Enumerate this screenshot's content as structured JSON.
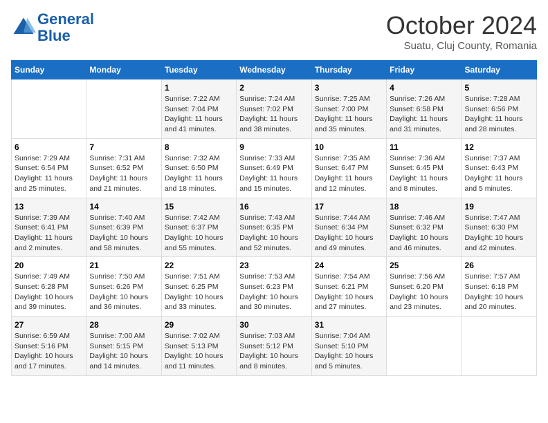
{
  "header": {
    "logo_line1": "General",
    "logo_line2": "Blue",
    "month": "October 2024",
    "location": "Suatu, Cluj County, Romania"
  },
  "weekdays": [
    "Sunday",
    "Monday",
    "Tuesday",
    "Wednesday",
    "Thursday",
    "Friday",
    "Saturday"
  ],
  "weeks": [
    [
      {
        "day": "",
        "info": ""
      },
      {
        "day": "",
        "info": ""
      },
      {
        "day": "1",
        "info": "Sunrise: 7:22 AM\nSunset: 7:04 PM\nDaylight: 11 hours and 41 minutes."
      },
      {
        "day": "2",
        "info": "Sunrise: 7:24 AM\nSunset: 7:02 PM\nDaylight: 11 hours and 38 minutes."
      },
      {
        "day": "3",
        "info": "Sunrise: 7:25 AM\nSunset: 7:00 PM\nDaylight: 11 hours and 35 minutes."
      },
      {
        "day": "4",
        "info": "Sunrise: 7:26 AM\nSunset: 6:58 PM\nDaylight: 11 hours and 31 minutes."
      },
      {
        "day": "5",
        "info": "Sunrise: 7:28 AM\nSunset: 6:56 PM\nDaylight: 11 hours and 28 minutes."
      }
    ],
    [
      {
        "day": "6",
        "info": "Sunrise: 7:29 AM\nSunset: 6:54 PM\nDaylight: 11 hours and 25 minutes."
      },
      {
        "day": "7",
        "info": "Sunrise: 7:31 AM\nSunset: 6:52 PM\nDaylight: 11 hours and 21 minutes."
      },
      {
        "day": "8",
        "info": "Sunrise: 7:32 AM\nSunset: 6:50 PM\nDaylight: 11 hours and 18 minutes."
      },
      {
        "day": "9",
        "info": "Sunrise: 7:33 AM\nSunset: 6:49 PM\nDaylight: 11 hours and 15 minutes."
      },
      {
        "day": "10",
        "info": "Sunrise: 7:35 AM\nSunset: 6:47 PM\nDaylight: 11 hours and 12 minutes."
      },
      {
        "day": "11",
        "info": "Sunrise: 7:36 AM\nSunset: 6:45 PM\nDaylight: 11 hours and 8 minutes."
      },
      {
        "day": "12",
        "info": "Sunrise: 7:37 AM\nSunset: 6:43 PM\nDaylight: 11 hours and 5 minutes."
      }
    ],
    [
      {
        "day": "13",
        "info": "Sunrise: 7:39 AM\nSunset: 6:41 PM\nDaylight: 11 hours and 2 minutes."
      },
      {
        "day": "14",
        "info": "Sunrise: 7:40 AM\nSunset: 6:39 PM\nDaylight: 10 hours and 58 minutes."
      },
      {
        "day": "15",
        "info": "Sunrise: 7:42 AM\nSunset: 6:37 PM\nDaylight: 10 hours and 55 minutes."
      },
      {
        "day": "16",
        "info": "Sunrise: 7:43 AM\nSunset: 6:35 PM\nDaylight: 10 hours and 52 minutes."
      },
      {
        "day": "17",
        "info": "Sunrise: 7:44 AM\nSunset: 6:34 PM\nDaylight: 10 hours and 49 minutes."
      },
      {
        "day": "18",
        "info": "Sunrise: 7:46 AM\nSunset: 6:32 PM\nDaylight: 10 hours and 46 minutes."
      },
      {
        "day": "19",
        "info": "Sunrise: 7:47 AM\nSunset: 6:30 PM\nDaylight: 10 hours and 42 minutes."
      }
    ],
    [
      {
        "day": "20",
        "info": "Sunrise: 7:49 AM\nSunset: 6:28 PM\nDaylight: 10 hours and 39 minutes."
      },
      {
        "day": "21",
        "info": "Sunrise: 7:50 AM\nSunset: 6:26 PM\nDaylight: 10 hours and 36 minutes."
      },
      {
        "day": "22",
        "info": "Sunrise: 7:51 AM\nSunset: 6:25 PM\nDaylight: 10 hours and 33 minutes."
      },
      {
        "day": "23",
        "info": "Sunrise: 7:53 AM\nSunset: 6:23 PM\nDaylight: 10 hours and 30 minutes."
      },
      {
        "day": "24",
        "info": "Sunrise: 7:54 AM\nSunset: 6:21 PM\nDaylight: 10 hours and 27 minutes."
      },
      {
        "day": "25",
        "info": "Sunrise: 7:56 AM\nSunset: 6:20 PM\nDaylight: 10 hours and 23 minutes."
      },
      {
        "day": "26",
        "info": "Sunrise: 7:57 AM\nSunset: 6:18 PM\nDaylight: 10 hours and 20 minutes."
      }
    ],
    [
      {
        "day": "27",
        "info": "Sunrise: 6:59 AM\nSunset: 5:16 PM\nDaylight: 10 hours and 17 minutes."
      },
      {
        "day": "28",
        "info": "Sunrise: 7:00 AM\nSunset: 5:15 PM\nDaylight: 10 hours and 14 minutes."
      },
      {
        "day": "29",
        "info": "Sunrise: 7:02 AM\nSunset: 5:13 PM\nDaylight: 10 hours and 11 minutes."
      },
      {
        "day": "30",
        "info": "Sunrise: 7:03 AM\nSunset: 5:12 PM\nDaylight: 10 hours and 8 minutes."
      },
      {
        "day": "31",
        "info": "Sunrise: 7:04 AM\nSunset: 5:10 PM\nDaylight: 10 hours and 5 minutes."
      },
      {
        "day": "",
        "info": ""
      },
      {
        "day": "",
        "info": ""
      }
    ]
  ]
}
